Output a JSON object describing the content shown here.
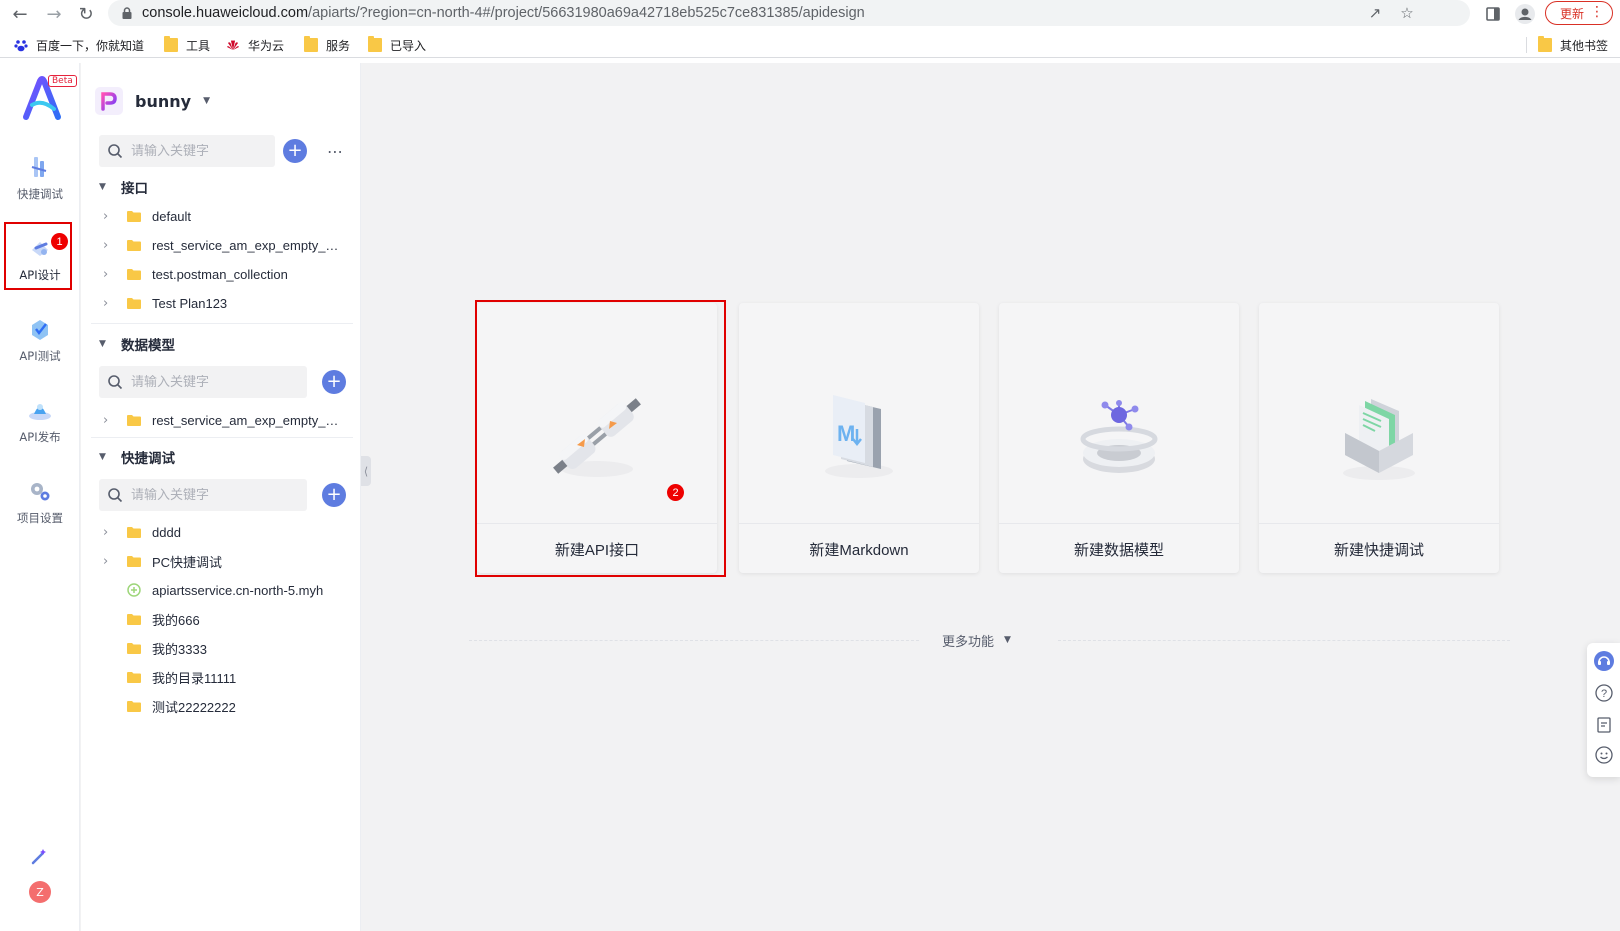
{
  "browser": {
    "url_host": "console.huaweicloud.com",
    "url_path": "/apiarts/?region=cn-north-4#/project/56631980a69a42718eb525c7ce831385/apidesign",
    "update_label": "更新",
    "bookmarks": [
      {
        "label": "百度一下，你就知道",
        "icon": "baidu-icon"
      },
      {
        "label": "工具",
        "icon": "folder-icon"
      },
      {
        "label": "华为云",
        "icon": "huawei-icon"
      },
      {
        "label": "服务",
        "icon": "folder-icon"
      },
      {
        "label": "已导入",
        "icon": "folder-icon"
      }
    ],
    "other_bookmarks": "其他书签"
  },
  "rail": {
    "beta": "Beta",
    "items": [
      {
        "label": "快捷调试",
        "icon": "quick-debug-icon"
      },
      {
        "label": "API设计",
        "icon": "api-design-icon",
        "active": true,
        "badge": "1"
      },
      {
        "label": "API测试",
        "icon": "api-test-icon"
      },
      {
        "label": "API发布",
        "icon": "api-publish-icon"
      },
      {
        "label": "项目设置",
        "icon": "project-settings-icon"
      }
    ],
    "avatar": "Z"
  },
  "panel": {
    "project_name": "bunny",
    "search_placeholder": "请输入关键字",
    "sections": {
      "interfaces": {
        "title": "接口",
        "items": [
          "default",
          "rest_service_am_exp_empty_resource",
          "test.postman_collection",
          "Test Plan123"
        ]
      },
      "models": {
        "title": "数据模型",
        "items": [
          "rest_service_am_exp_empty_resource"
        ]
      },
      "quick": {
        "title": "快捷调试",
        "items": [
          "dddd",
          "PC快捷调试",
          "apiartsservice.cn-north-5.myh",
          "我的666",
          "我的3333",
          "我的目录11111",
          "测试22222222"
        ]
      }
    }
  },
  "main": {
    "cards": [
      {
        "label": "新建API接口",
        "icon": "plug-icon",
        "badge": "2"
      },
      {
        "label": "新建Markdown",
        "icon": "markdown-icon"
      },
      {
        "label": "新建数据模型",
        "icon": "data-model-icon"
      },
      {
        "label": "新建快捷调试",
        "icon": "quick-debug-folder-icon"
      }
    ],
    "more_functions": "更多功能"
  },
  "colors": {
    "primary": "#5e7ce0",
    "highlight_red": "#e00000",
    "folder": "#f9c846"
  }
}
